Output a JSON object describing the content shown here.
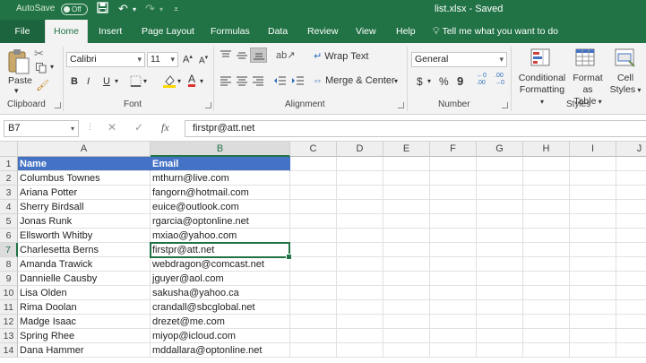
{
  "titlebar": {
    "autosave_label": "AutoSave",
    "autosave_state": "Off",
    "doc_title": "list.xlsx  -  Saved",
    "qat_icons": [
      "save-icon",
      "undo-icon",
      "redo-icon",
      "customize-icon"
    ]
  },
  "tabs": [
    "File",
    "Home",
    "Insert",
    "Page Layout",
    "Formulas",
    "Data",
    "Review",
    "View",
    "Help"
  ],
  "active_tab": "Home",
  "tell_me": "Tell me what you want to do",
  "ribbon": {
    "clipboard": {
      "label": "Clipboard",
      "paste": "Paste"
    },
    "font": {
      "label": "Font",
      "name": "Calibri",
      "size": "11",
      "bold": "B",
      "italic": "I",
      "underline": "U"
    },
    "alignment": {
      "label": "Alignment",
      "wrap_text": "Wrap Text",
      "merge_center": "Merge & Center"
    },
    "number": {
      "label": "Number",
      "format": "General",
      "currency": "$",
      "percent": "%",
      "comma": "9"
    },
    "styles": {
      "label": "Styles",
      "conditional": [
        "Conditional",
        "Formatting"
      ],
      "format_table": [
        "Format as",
        "Table"
      ],
      "cell_styles": [
        "Cell",
        "Styles"
      ]
    }
  },
  "formula_bar": {
    "name_box": "B7",
    "fx": "fx",
    "content": "firstpr@att.net"
  },
  "sheet": {
    "columns": [
      "A",
      "B",
      "C",
      "D",
      "E",
      "F",
      "G",
      "H",
      "I",
      "J"
    ],
    "selected_column": "B",
    "selected_row": 7,
    "rows": [
      {
        "n": 1,
        "a": "Name",
        "b": "Email"
      },
      {
        "n": 2,
        "a": "Columbus Townes",
        "b": "mthurn@live.com"
      },
      {
        "n": 3,
        "a": "Ariana Potter",
        "b": "fangorn@hotmail.com"
      },
      {
        "n": 4,
        "a": "Sherry Birdsall",
        "b": "euice@outlook.com"
      },
      {
        "n": 5,
        "a": "Jonas Runk",
        "b": "rgarcia@optonline.net"
      },
      {
        "n": 6,
        "a": "Ellsworth Whitby",
        "b": "mxiao@yahoo.com"
      },
      {
        "n": 7,
        "a": "Charlesetta Berns",
        "b": "firstpr@att.net"
      },
      {
        "n": 8,
        "a": "Amanda Trawick",
        "b": "webdragon@comcast.net"
      },
      {
        "n": 9,
        "a": "Dannielle Causby",
        "b": "jguyer@aol.com"
      },
      {
        "n": 10,
        "a": "Lisa Olden",
        "b": "sakusha@yahoo.ca"
      },
      {
        "n": 11,
        "a": "Rima Doolan",
        "b": "crandall@sbcglobal.net"
      },
      {
        "n": 12,
        "a": "Madge Isaac",
        "b": "drezet@me.com"
      },
      {
        "n": 13,
        "a": "Spring Rhee",
        "b": "miyop@icloud.com"
      },
      {
        "n": 14,
        "a": "Dana Hammer",
        "b": "mddallara@optonline.net"
      }
    ]
  },
  "colors": {
    "excel_green": "#217346",
    "header_fill": "#4472c4"
  }
}
